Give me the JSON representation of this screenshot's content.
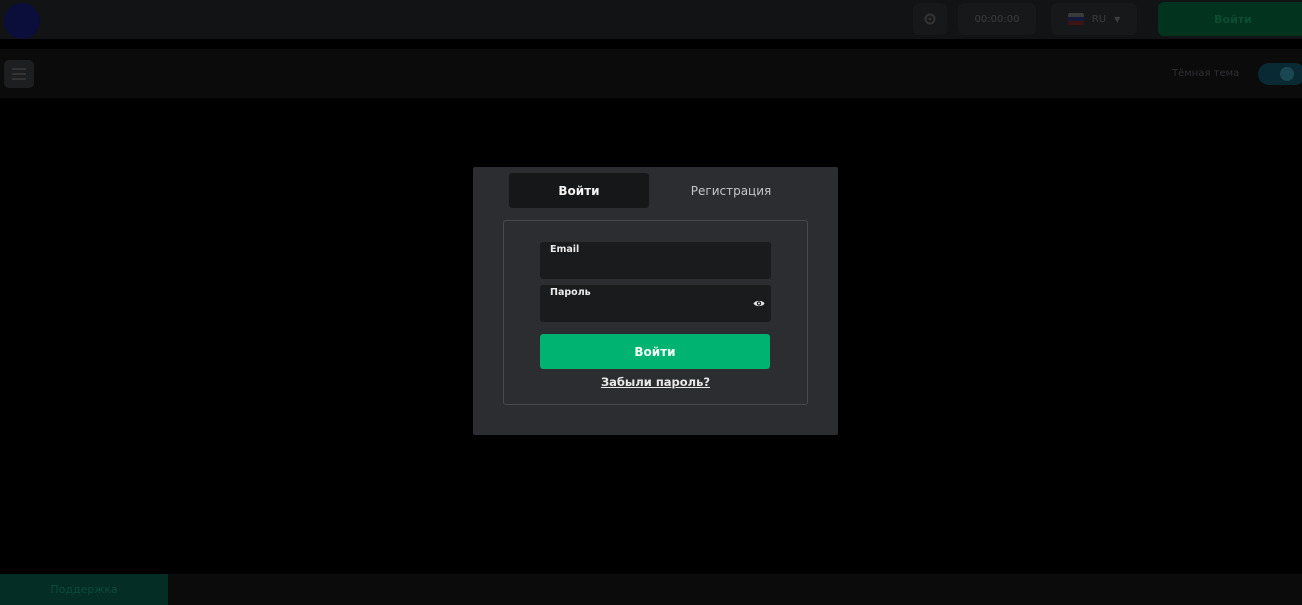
{
  "header": {
    "logo_icon": "circle-logo-icon",
    "settings_icon": "gear-icon",
    "clock_text": "00:00:00",
    "language": {
      "flag_icon": "flag-ru-icon",
      "code": "RU",
      "chevron_icon": "chevron-down-icon"
    },
    "login_label": "Войти"
  },
  "subheader": {
    "menu_icon": "hamburger-icon",
    "theme_label": "Тёмная тема"
  },
  "footer": {
    "button_label": "Поддержка"
  },
  "modal": {
    "tabs": [
      {
        "label": "Войти",
        "active": true
      },
      {
        "label": "Регистрация",
        "active": false
      }
    ],
    "email": {
      "label": "Email",
      "value": ""
    },
    "password": {
      "label": "Пароль",
      "value": "",
      "toggle_icon": "eye-icon"
    },
    "submit_label": "Войти",
    "forgot_label": "Забыли пароль?"
  },
  "colors": {
    "accent": "#01b371",
    "modal_bg": "#2c2d30",
    "field_bg": "#1a1b1d",
    "active_tab_bg": "#161719"
  }
}
